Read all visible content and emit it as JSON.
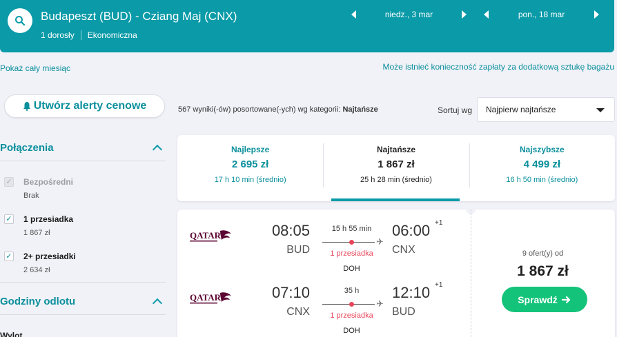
{
  "header": {
    "route": "Budapeszt (BUD) - Cziang Maj (CNX)",
    "passengers": "1 dorosły",
    "cabin_class": "Ekonomiczna",
    "outbound_date": "niedz., 3 mar",
    "return_date": "pon., 18 mar"
  },
  "links": {
    "show_month": "Pokaż cały miesiąc",
    "baggage_notice": "Może istnieć konieczność zapłaty za dodatkową sztukę bagażu"
  },
  "sidebar": {
    "alert_button": "Utwórz alerty cenowe",
    "connections_title": "Połączenia",
    "options": [
      {
        "label": "Bezpośredni",
        "sub": "Brak",
        "checked": true,
        "disabled": true
      },
      {
        "label": "1 przesiadka",
        "sub": "1 867 zł",
        "checked": true,
        "disabled": false
      },
      {
        "label": "2+ przesiadki",
        "sub": "2 634 zł",
        "checked": true,
        "disabled": false
      }
    ],
    "departure_title": "Godziny odlotu",
    "departure_sub": "Wylot"
  },
  "results": {
    "count_text": "567 wyniki(-ów) posortowane(-ych) wg kategorii:",
    "sort_category": "Najtańsze",
    "sort_label": "Sortuj wg",
    "sort_value": "Najpierw najtańsze"
  },
  "tabs": [
    {
      "title": "Najlepsze",
      "price": "2 695 zł",
      "duration": "17 h 10 min (średnio)",
      "active": false
    },
    {
      "title": "Najtańsze",
      "price": "1 867 zł",
      "duration": "25 h 28 min (średnio)",
      "active": true
    },
    {
      "title": "Najszybsze",
      "price": "4 499 zł",
      "duration": "16 h 50 min (średnio)",
      "active": false
    }
  ],
  "result": {
    "legs": [
      {
        "airline": "Qatar Airways",
        "dep_time": "08:05",
        "dep_code": "BUD",
        "duration": "15 h 55 min",
        "stops": "1 przesiadka",
        "via": "DOH",
        "arr_time": "06:00",
        "arr_code": "CNX",
        "day_offset": "+1"
      },
      {
        "airline": "Qatar Airways",
        "dep_time": "07:10",
        "dep_code": "CNX",
        "duration": "35 h",
        "stops": "1 przesiadka",
        "via": "DOH",
        "arr_time": "12:10",
        "arr_code": "BUD",
        "day_offset": "+1"
      }
    ],
    "offers": "9 ofert(y) od",
    "price": "1 867 zł",
    "select_label": "Sprawdź"
  },
  "colors": {
    "brand": "#0a9aa8",
    "link": "#0a8f9c",
    "stop_red": "#e8455a",
    "cta_green": "#14c37a",
    "qatar_maroon": "#5c0632"
  }
}
